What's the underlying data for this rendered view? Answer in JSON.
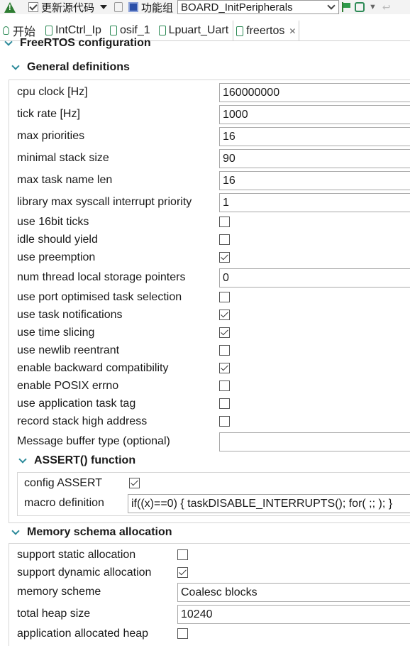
{
  "toolbar": {
    "update_label": "更新源代码",
    "function_group_label": "功能组",
    "function_group_value": "BOARD_InitPeripherals"
  },
  "tabs": [
    {
      "label": "开始"
    },
    {
      "label": "IntCtrl_Ip"
    },
    {
      "label": "osif_1"
    },
    {
      "label": "Lpuart_Uart"
    },
    {
      "label": "freertos"
    }
  ],
  "page_title": "FreeRTOS configuration",
  "general": {
    "title": "General definitions",
    "cpu_clock": {
      "label": "cpu clock [Hz]",
      "value": "160000000"
    },
    "tick_rate": {
      "label": "tick rate [Hz]",
      "value": "1000"
    },
    "max_priorities": {
      "label": "max priorities",
      "value": "16"
    },
    "min_stack": {
      "label": "minimal stack size",
      "value": "90"
    },
    "max_task_name": {
      "label": "max task name len",
      "value": "16"
    },
    "lib_max_syscall": {
      "label": "library max syscall interrupt priority",
      "value": "1"
    },
    "use_16bit_ticks": {
      "label": "use 16bit ticks",
      "checked": false
    },
    "idle_yield": {
      "label": "idle should yield",
      "checked": false
    },
    "use_preemption": {
      "label": "use preemption",
      "checked": true
    },
    "num_tls": {
      "label": "num thread local storage pointers",
      "value": "0"
    },
    "port_opt": {
      "label": "use port optimised task selection",
      "checked": false
    },
    "task_notif": {
      "label": "use task notifications",
      "checked": true
    },
    "time_slicing": {
      "label": "use time slicing",
      "checked": true
    },
    "newlib": {
      "label": "use newlib reentrant",
      "checked": false
    },
    "backward": {
      "label": "enable backward compatibility",
      "checked": true
    },
    "posix": {
      "label": "enable POSIX errno",
      "checked": false
    },
    "app_tag": {
      "label": "use application task tag",
      "checked": false
    },
    "stack_high": {
      "label": "record stack high address",
      "checked": false
    },
    "msg_buffer": {
      "label": "Message buffer type (optional)",
      "value": ""
    }
  },
  "assert": {
    "title": "ASSERT() function",
    "config_assert": {
      "label": "config ASSERT",
      "checked": true
    },
    "macro": {
      "label": "macro definition",
      "value": "if((x)==0) { taskDISABLE_INTERRUPTS(); for( ;; ); }"
    }
  },
  "memory": {
    "title": "Memory schema allocation",
    "static_alloc": {
      "label": "support static allocation",
      "checked": false
    },
    "dynamic_alloc": {
      "label": "support dynamic allocation",
      "checked": true
    },
    "scheme": {
      "label": "memory scheme",
      "value": "Coalesc blocks"
    },
    "heap_size": {
      "label": "total heap size",
      "value": "10240"
    },
    "app_heap": {
      "label": "application allocated heap",
      "checked": false
    }
  }
}
